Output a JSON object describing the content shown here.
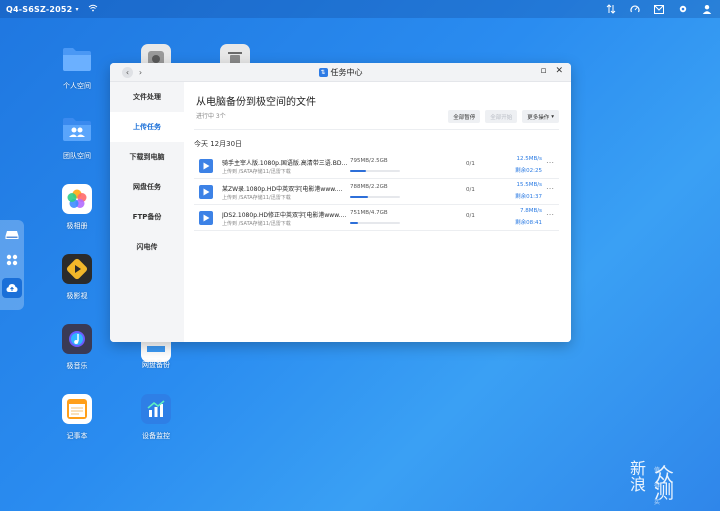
{
  "topbar": {
    "device": "Q4-S6SZ-2052",
    "icons": [
      "transfer-icon",
      "dashboard-icon",
      "message-icon",
      "settings-icon",
      "user-icon"
    ]
  },
  "desktop": {
    "icons": [
      {
        "name": "personal-space",
        "label": "个人空间",
        "color": "#3c8df0"
      },
      {
        "name": "team-space",
        "label": "团队空间",
        "color": "#2e7fe6"
      },
      {
        "name": "photos",
        "label": "极相册",
        "color": "#ffffff"
      },
      {
        "name": "video",
        "label": "极影视",
        "color": "#2b2b2b"
      },
      {
        "name": "music",
        "label": "极音乐",
        "color": "#3b3b5a"
      },
      {
        "name": "notes",
        "label": "记事本",
        "color": "#ffffff"
      },
      {
        "name": "cloud-backup",
        "label": "网盘备份",
        "color": "#ffffff"
      },
      {
        "name": "device-monitor",
        "label": "设备监控",
        "color": "#2e7fe6"
      }
    ]
  },
  "window": {
    "title": "任务中心",
    "sidebar": [
      {
        "label": "文件处理",
        "active": false
      },
      {
        "label": "上传任务",
        "active": true
      },
      {
        "label": "下载到电脑",
        "active": false
      },
      {
        "label": "网盘任务",
        "active": false
      },
      {
        "label": "FTP备份",
        "active": false
      },
      {
        "label": "闪电传",
        "active": false
      }
    ],
    "main": {
      "heading": "从电脑备份到极空间的文件",
      "subtitle": "进行中 3个",
      "buttons": {
        "pause_all": "全部暂停",
        "start_all": "全部开始",
        "more": "更多操作"
      },
      "date": "今天  12月30日",
      "tasks": [
        {
          "name": "骑手主宰人版.1080p.国语版.高清带三语.BD…",
          "path": "上传到 /SATA存储11/迅雷下载",
          "size": "795MB/2.5GB",
          "progress": 0.31,
          "count": "0/1",
          "speed": "12.5MB/s",
          "remaining": "剩余02:25"
        },
        {
          "name": "某ZW录.1080p.HD中英双字[电影港www.…",
          "path": "上传到 /SATA存储11/迅雷下载",
          "size": "788MB/2.2GB",
          "progress": 0.35,
          "count": "0/1",
          "speed": "15.5MB/s",
          "remaining": "剩余01:37"
        },
        {
          "name": "JDS2.1080p.HD修正中英双字[电影港www.…",
          "path": "上传到 /SATA存储11/迅雷下载",
          "size": "751MB/4.7GB",
          "progress": 0.16,
          "count": "0/1",
          "speed": "7.8MB/s",
          "remaining": "剩余08:41"
        }
      ]
    }
  },
  "watermark": {
    "line1": "新",
    "line2": "浪",
    "big": "众测",
    "small": "值得买"
  }
}
